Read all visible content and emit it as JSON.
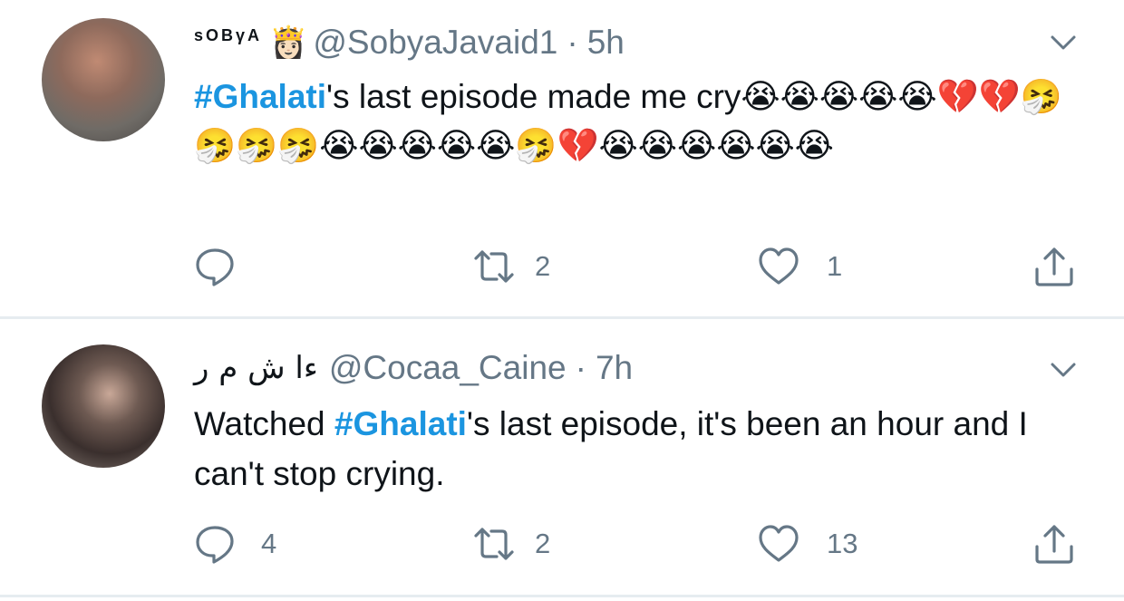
{
  "tweets": [
    {
      "display_name": "sOBγA",
      "name_emoji": "👸🏻",
      "handle": "@SobyaJavaid1",
      "separator": "·",
      "time": "5h",
      "hashtag": "#Ghalati",
      "text_after_hashtag": "'s last episode made me cry😭😭😭😭😭💔💔🤧🤧🤧🤧😭😭😭😭😭🤧💔😭😭😭😭😭😭",
      "reply_count": "",
      "retweet_count": "2",
      "like_count": "1"
    },
    {
      "display_name": "ءا ش م ر",
      "handle": "@Cocaa_Caine",
      "separator": "·",
      "time": "7h",
      "text_before_hashtag": "Watched ",
      "hashtag": "#Ghalati",
      "text_after_hashtag": "'s last episode, it's been an hour and I can't stop crying.",
      "reply_count": "4",
      "retweet_count": "2",
      "like_count": "13"
    }
  ],
  "icons": {
    "reply": "speech-bubble",
    "retweet": "retweet-arrows",
    "like": "heart-outline",
    "share": "share-upload",
    "menu": "chevron-down"
  },
  "colors": {
    "hashtag": "#1b95e0",
    "secondary_text": "#657786",
    "divider": "#e6ecf0"
  }
}
